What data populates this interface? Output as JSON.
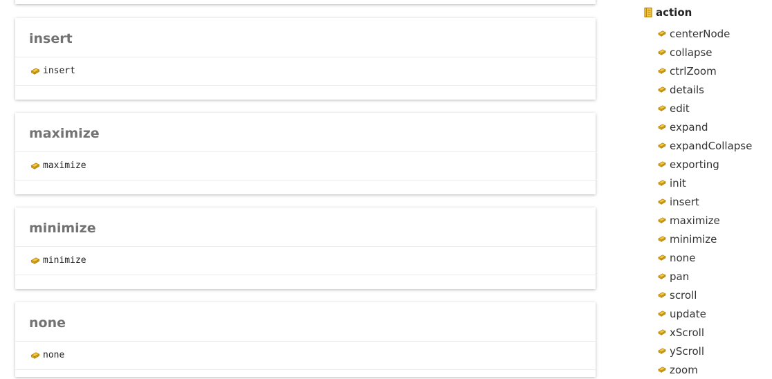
{
  "cards": [
    {
      "title": "insert",
      "member": "insert"
    },
    {
      "title": "maximize",
      "member": "maximize"
    },
    {
      "title": "minimize",
      "member": "minimize"
    },
    {
      "title": "none",
      "member": "none"
    }
  ],
  "sidebar": {
    "namespace": "action",
    "items": [
      "centerNode",
      "collapse",
      "ctrlZoom",
      "details",
      "edit",
      "expand",
      "expandCollapse",
      "exporting",
      "init",
      "insert",
      "maximize",
      "minimize",
      "none",
      "pan",
      "scroll",
      "update",
      "xScroll",
      "yScroll",
      "zoom"
    ]
  },
  "colors": {
    "icon": "#d4a017",
    "title": "#727272",
    "text": "#333333"
  },
  "icons": {
    "namespace": "namespace-icon",
    "member": "member-icon"
  }
}
